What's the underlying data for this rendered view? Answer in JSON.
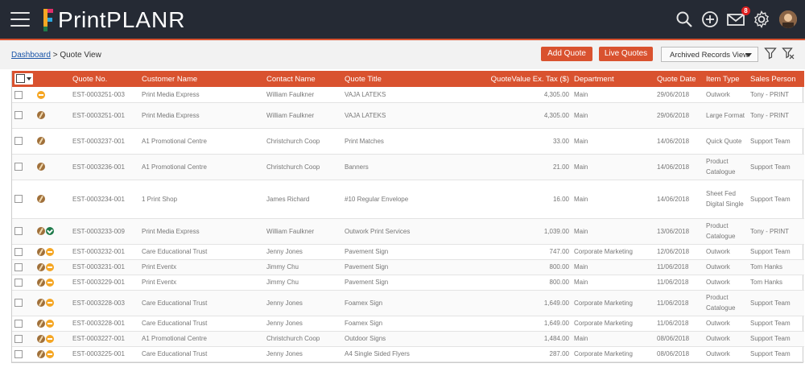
{
  "app": {
    "brand_first": "Print",
    "brand_second": "PLANR",
    "notification_count": "8",
    "accent_color": "#d9522f",
    "header_color": "#252a34"
  },
  "toolbar": {
    "breadcrumb_link": "Dashboard",
    "breadcrumb_current": " > Quote View",
    "add_quote_label": "Add Quote",
    "live_quotes_label": "Live Quotes",
    "archived_dropdown_value": "Archived Records View"
  },
  "table": {
    "columns": {
      "quote_no": "Quote No.",
      "customer_name": "Customer Name",
      "contact_name": "Contact Name",
      "quote_title": "Quote Title",
      "quote_value": "QuoteValue Ex. Tax ($)",
      "department": "Department",
      "quote_date": "Quote Date",
      "item_type": "Item Type",
      "sales_person": "Sales Person"
    },
    "rows": [
      {
        "icons": [
          "orange"
        ],
        "quote_no": "EST-0003251-003",
        "customer": "Print Media Express",
        "contact": "William Faulkner",
        "title": "VAJA LATEKS",
        "value": "4,305.00",
        "department": "Main",
        "date": "29/06/2018",
        "item_type": "Outwork",
        "sales": "Tony - PRINT"
      },
      {
        "icons": [
          "brown"
        ],
        "quote_no": "EST-0003251-001",
        "customer": "Print Media Express",
        "contact": "William Faulkner",
        "title": "VAJA LATEKS",
        "value": "4,305.00",
        "department": "Main",
        "date": "29/06/2018",
        "item_type": "Large Format",
        "sales": "Tony - PRINT"
      },
      {
        "icons": [
          "brown"
        ],
        "quote_no": "EST-0003237-001",
        "customer": "A1 Promotional Centre",
        "contact": "Christchurch Coop",
        "title": "Print Matches",
        "value": "33.00",
        "department": "Main",
        "date": "14/06/2018",
        "item_type": "Quick Quote",
        "sales": "Support Team"
      },
      {
        "icons": [
          "brown"
        ],
        "quote_no": "EST-0003236-001",
        "customer": "A1 Promotional Centre",
        "contact": "Christchurch Coop",
        "title": "Banners",
        "value": "21.00",
        "department": "Main",
        "date": "14/06/2018",
        "item_type": "Product Catalogue",
        "sales": "Support Team"
      },
      {
        "icons": [
          "brown"
        ],
        "quote_no": "EST-0003234-001",
        "customer": "1 Print Shop",
        "contact": "James Richard",
        "title": "#10 Regular Envelope",
        "value": "16.00",
        "department": "Main",
        "date": "14/06/2018",
        "item_type": "Sheet Fed Digital Single",
        "sales": "Support Team"
      },
      {
        "icons": [
          "brown",
          "green"
        ],
        "quote_no": "EST-0003233-009",
        "customer": "Print Media Express",
        "contact": "William Faulkner",
        "title": "Outwork Print Services",
        "value": "1,039.00",
        "department": "Main",
        "date": "13/06/2018",
        "item_type": "Product Catalogue",
        "sales": "Tony - PRINT"
      },
      {
        "icons": [
          "brown",
          "orange"
        ],
        "quote_no": "EST-0003232-001",
        "customer": "Care Educational Trust",
        "contact": "Jenny Jones",
        "title": "Pavement Sign",
        "value": "747.00",
        "department": "Corporate Marketing",
        "date": "12/06/2018",
        "item_type": "Outwork",
        "sales": "Support Team"
      },
      {
        "icons": [
          "brown",
          "orange"
        ],
        "quote_no": "EST-0003231-001",
        "customer": "Print Eventx",
        "contact": "Jimmy Chu",
        "title": "Pavement Sign",
        "value": "800.00",
        "department": "Main",
        "date": "11/06/2018",
        "item_type": "Outwork",
        "sales": "Tom Hanks"
      },
      {
        "icons": [
          "brown",
          "orange"
        ],
        "quote_no": "EST-0003229-001",
        "customer": "Print Eventx",
        "contact": "Jimmy Chu",
        "title": "Pavement Sign",
        "value": "800.00",
        "department": "Main",
        "date": "11/06/2018",
        "item_type": "Outwork",
        "sales": "Tom Hanks"
      },
      {
        "icons": [
          "brown",
          "orange"
        ],
        "quote_no": "EST-0003228-003",
        "customer": "Care Educational Trust",
        "contact": "Jenny Jones",
        "title": "Foamex Sign",
        "value": "1,649.00",
        "department": "Corporate Marketing",
        "date": "11/06/2018",
        "item_type": "Product Catalogue",
        "sales": "Support Team"
      },
      {
        "icons": [
          "brown",
          "orange"
        ],
        "quote_no": "EST-0003228-001",
        "customer": "Care Educational Trust",
        "contact": "Jenny Jones",
        "title": "Foamex Sign",
        "value": "1,649.00",
        "department": "Corporate Marketing",
        "date": "11/06/2018",
        "item_type": "Outwork",
        "sales": "Support Team"
      },
      {
        "icons": [
          "brown",
          "orange"
        ],
        "quote_no": "EST-0003227-001",
        "customer": "A1 Promotional Centre",
        "contact": "Christchurch Coop",
        "title": "Outdoor Signs",
        "value": "1,484.00",
        "department": "Main",
        "date": "08/06/2018",
        "item_type": "Outwork",
        "sales": "Support Team"
      },
      {
        "icons": [
          "brown",
          "orange"
        ],
        "quote_no": "EST-0003225-001",
        "customer": "Care Educational Trust",
        "contact": "Jenny Jones",
        "title": "A4 Single Sided Flyers",
        "value": "287.00",
        "department": "Corporate Marketing",
        "date": "08/06/2018",
        "item_type": "Outwork",
        "sales": "Support Team"
      }
    ]
  }
}
